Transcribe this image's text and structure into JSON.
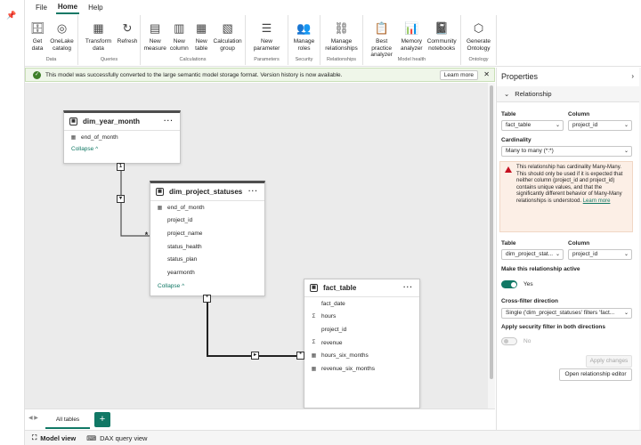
{
  "tabs": [
    "File",
    "Home",
    "Help"
  ],
  "ribbon": [
    {
      "group": "Data",
      "buttons": [
        {
          "label": "Get data",
          "icon": "database-icon"
        },
        {
          "label": "OneLake catalog",
          "icon": "onelake-icon"
        }
      ]
    },
    {
      "group": "Queries",
      "buttons": [
        {
          "label": "Transform data",
          "icon": "transform-icon"
        },
        {
          "label": "Refresh",
          "icon": "refresh-icon"
        }
      ]
    },
    {
      "group": "Calculations",
      "buttons": [
        {
          "label": "New measure",
          "icon": "calculator-icon"
        },
        {
          "label": "New column",
          "icon": "column-icon"
        },
        {
          "label": "New table",
          "icon": "table-icon"
        },
        {
          "label": "Calculation group",
          "icon": "calc-group-icon"
        }
      ]
    },
    {
      "group": "Parameters",
      "buttons": [
        {
          "label": "New parameter",
          "icon": "parameter-icon"
        }
      ]
    },
    {
      "group": "Security",
      "buttons": [
        {
          "label": "Manage roles",
          "icon": "roles-icon"
        }
      ]
    },
    {
      "group": "Relationships",
      "buttons": [
        {
          "label": "Manage relationships",
          "icon": "relationships-icon"
        }
      ]
    },
    {
      "group": "Model health",
      "buttons": [
        {
          "label": "Best practice analyzer",
          "icon": "best-practice-icon"
        },
        {
          "label": "Memory analyzer",
          "icon": "memory-icon"
        },
        {
          "label": "Community notebooks",
          "icon": "notebook-icon"
        }
      ]
    },
    {
      "group": "Ontology",
      "buttons": [
        {
          "label": "Generate Ontology",
          "icon": "ontology-icon"
        }
      ]
    }
  ],
  "notification": {
    "text": "This model was successfully converted to the large semantic model storage format. Version history is now available.",
    "learn_more": "Learn more",
    "close": "✕"
  },
  "tables": {
    "dim_year_month": {
      "name": "dim_year_month",
      "fields": [
        {
          "name": "end_of_month",
          "icon": "calendar-icon"
        }
      ],
      "collapse": "Collapse ^"
    },
    "dim_project_statuses": {
      "name": "dim_project_statuses",
      "fields": [
        {
          "name": "end_of_month",
          "icon": "calendar-icon"
        },
        {
          "name": "project_id"
        },
        {
          "name": "project_name"
        },
        {
          "name": "status_health"
        },
        {
          "name": "status_plan"
        },
        {
          "name": "yearmonth"
        }
      ],
      "collapse": "Collapse ^"
    },
    "fact_table": {
      "name": "fact_table",
      "fields": [
        {
          "name": "fact_date"
        },
        {
          "name": "hours",
          "icon": "sigma-icon"
        },
        {
          "name": "project_id"
        },
        {
          "name": "revenue",
          "icon": "sigma-icon"
        },
        {
          "name": "hours_six_months",
          "icon": "calendar-icon"
        },
        {
          "name": "revenue_six_months",
          "icon": "calendar-icon"
        }
      ]
    }
  },
  "cardinality_markers": {
    "one": "1",
    "many": "*"
  },
  "bottom_tabs": {
    "all_tables": "All tables",
    "add": "+"
  },
  "views": [
    {
      "label": "Model view",
      "icon": "model-view-icon"
    },
    {
      "label": "DAX query view",
      "icon": "dax-icon"
    }
  ],
  "properties": {
    "title": "Properties",
    "section": "Relationship",
    "table_label": "Table",
    "column_label": "Column",
    "table1": "fact_table",
    "column1": "project_id",
    "cardinality_label": "Cardinality",
    "cardinality": "Many to many (*:*)",
    "warning": "This relationship has cardinality Many-Many. This should only be used if it is expected that neither column (project_id and project_id) contains unique values, and that the significantly different behavior of Many-Many relationships is understood.",
    "warning_link": "Learn more",
    "table2": "dim_project_stat...",
    "column2": "project_id",
    "active_label": "Make this relationship active",
    "active_value": "Yes",
    "crossfilter_label": "Cross-filter direction",
    "crossfilter": "Single ('dim_project_statuses' filters 'fact...",
    "security_label": "Apply security filter in both directions",
    "security_value": "No",
    "apply_button": "Apply changes",
    "open_editor_button": "Open relationship editor"
  }
}
